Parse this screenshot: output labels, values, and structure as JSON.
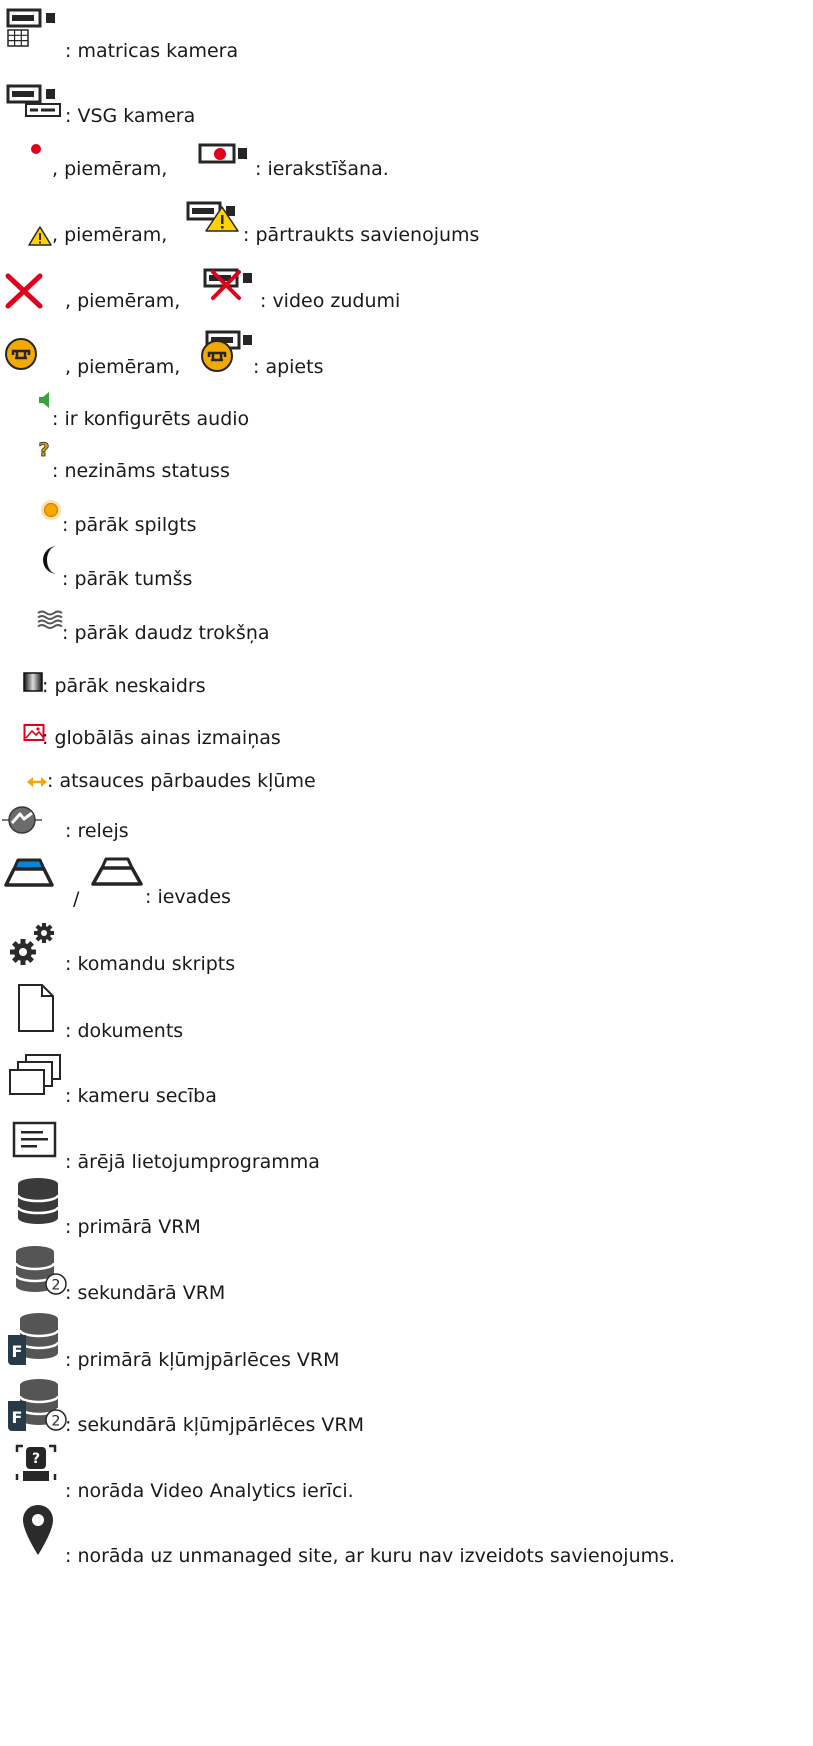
{
  "items": [
    {
      "icon": "matrix-camera-icon",
      "text": ": matricas kamera"
    },
    {
      "icon": "vsg-camera-icon",
      "text": ": VSG kamera"
    },
    {
      "icon": "recording-dot-icon",
      "text": ", piemēram,",
      "icon2": "camera-recording-icon",
      "text2": ": ierakstīšana."
    },
    {
      "icon": "warning-triangle-icon",
      "text": ", piemēram,",
      "icon2": "camera-warning-icon",
      "text2": ": pārtraukts savienojums"
    },
    {
      "icon": "red-x-icon",
      "text": ", piemēram,",
      "icon2": "camera-x-icon",
      "text2": ": video zudumi"
    },
    {
      "icon": "bypass-icon",
      "text": ", piemēram,",
      "icon2": "camera-bypass-icon",
      "text2": ": apiets"
    },
    {
      "icon": "speaker-icon",
      "text": ": ir konfigurēts audio"
    },
    {
      "icon": "question-mark-icon",
      "text": ": nezināms statuss"
    },
    {
      "icon": "sun-icon",
      "text": ": pārāk spilgts"
    },
    {
      "icon": "moon-icon",
      "text": ": pārāk tumšs"
    },
    {
      "icon": "noise-icon",
      "text": ": pārāk daudz trokšņa"
    },
    {
      "icon": "blur-icon",
      "text": ": pārāk neskaidrs"
    },
    {
      "icon": "scene-change-icon",
      "text": ": globālās ainas izmaiņas"
    },
    {
      "icon": "reference-arrows-icon",
      "text": ": atsauces pārbaudes kļūme"
    },
    {
      "icon": "relay-icon",
      "text": ": relejs"
    },
    {
      "icon": "input-active-icon",
      "text": "/",
      "icon2": "input-inactive-icon",
      "text2": ": ievades"
    },
    {
      "icon": "gears-icon",
      "text": ": komandu skripts"
    },
    {
      "icon": "document-icon",
      "text": ": dokuments"
    },
    {
      "icon": "sequence-icon",
      "text": ": kameru secība"
    },
    {
      "icon": "external-app-icon",
      "text": ": ārējā lietojumprogramma"
    },
    {
      "icon": "database-icon",
      "text": ": primārā VRM"
    },
    {
      "icon": "database-2-icon",
      "text": ": sekundārā VRM"
    },
    {
      "icon": "database-failover-icon",
      "text": ": primārā kļūmjpārlēces VRM"
    },
    {
      "icon": "database-failover-2-icon",
      "text": ": sekundārā kļūmjpārlēces VRM"
    },
    {
      "icon": "video-analytics-icon",
      "text": ": norāda Video Analytics ierīci."
    },
    {
      "icon": "map-pin-icon",
      "text": ": norāda uz unmanaged site, ar kuru nav izveidots savienojums."
    }
  ],
  "colors": {
    "text": "#1a1a1a",
    "icon_dark": "#262626",
    "red": "#e0001b",
    "yellow": "#ffd200",
    "orange": "#f2a900",
    "green": "#3aa23a",
    "blue": "#0a84d6"
  }
}
